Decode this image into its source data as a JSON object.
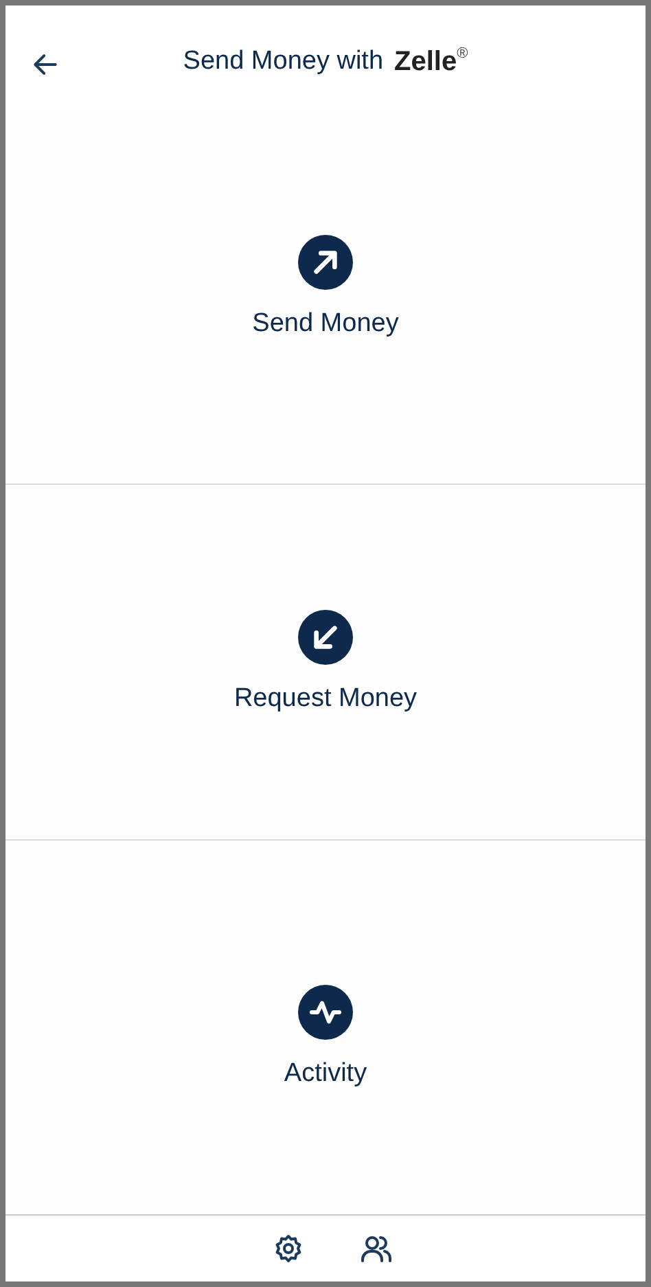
{
  "header": {
    "title": "Send Money with",
    "logo": {
      "text": "Zelle",
      "mark": "®"
    }
  },
  "actions": [
    {
      "kind": "send",
      "label": "Send Money"
    },
    {
      "kind": "request",
      "label": "Request Money"
    },
    {
      "kind": "activity",
      "label": "Activity"
    }
  ],
  "footer": {
    "items": [
      {
        "kind": "settings"
      },
      {
        "kind": "contacts"
      }
    ]
  }
}
